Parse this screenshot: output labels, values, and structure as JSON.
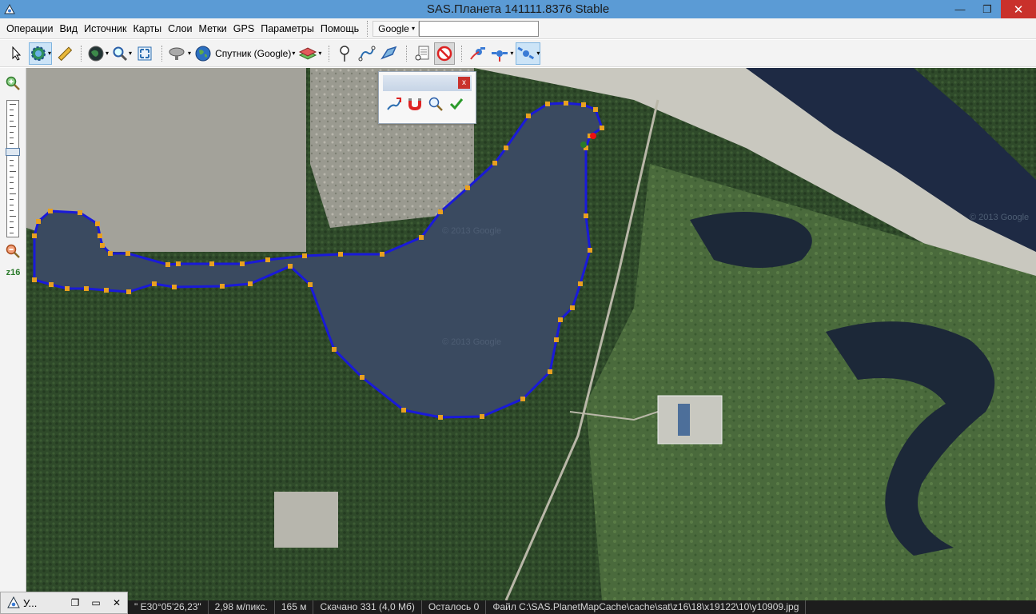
{
  "window": {
    "title": "SAS.Планета 141111.8376 Stable",
    "minimize_glyph": "—",
    "restore_glyph": "❐",
    "close_glyph": "✕"
  },
  "menu": {
    "items": [
      "Операции",
      "Вид",
      "Источник",
      "Карты",
      "Слои",
      "Метки",
      "GPS",
      "Параметры",
      "Помощь"
    ],
    "search_engine": "Google",
    "search_value": ""
  },
  "toolbar": {
    "map_source_label": "Спутник (Google)"
  },
  "palette": {
    "close_glyph": "x"
  },
  "zoom": {
    "level": "z16",
    "slider_fraction": 0.37
  },
  "map": {
    "watermarks": [
      "© 2013 Google",
      "© 2013 Google",
      "© 2013 Google"
    ]
  },
  "statusbar": {
    "coords": "\" E30°05'26,23\"",
    "scale": "2,98 м/пикс.",
    "distance": "165 м",
    "downloaded": "Скачано 331 (4,0 Мб)",
    "remaining": "Осталось 0",
    "file": "Файл C:\\SAS.PlanetMapCache\\cache\\sat\\z16\\18\\x19122\\10\\y10909.jpg"
  },
  "taskbar": {
    "label": "У..."
  },
  "colors": {
    "titlebar": "#5b9bd5",
    "water": "#34485e",
    "polygon_line": "#1a1ad8",
    "vertex": "#e8a020",
    "forest": "#2f4a2a"
  }
}
